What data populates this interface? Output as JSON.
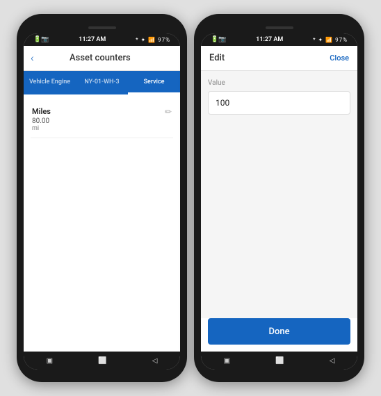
{
  "phone1": {
    "status_bar": {
      "left": "🔋📷",
      "right_icons": "* ✦ 📶 97%",
      "time": "11:27 AM"
    },
    "nav": {
      "back_label": "‹",
      "title": "Asset counters"
    },
    "tabs": [
      {
        "id": "vehicle-engine",
        "label": "Vehicle Engine",
        "active": false
      },
      {
        "id": "ny-01-wh-3",
        "label": "NY-01-WH-3",
        "active": false
      },
      {
        "id": "service",
        "label": "Service",
        "active": true
      }
    ],
    "counter": {
      "name": "Miles",
      "value": "80.00",
      "unit": "mi"
    },
    "bottom_nav": {
      "icons": [
        "▣",
        "⬜",
        "◁"
      ]
    }
  },
  "phone2": {
    "status_bar": {
      "left": "🔋📷",
      "right_icons": "* ✦ 📶 97%",
      "time": "11:27 AM"
    },
    "nav": {
      "edit_label": "Edit",
      "close_label": "Close"
    },
    "field": {
      "label": "Value",
      "value": "100"
    },
    "done_button": "Done",
    "bottom_nav": {
      "icons": [
        "▣",
        "⬜",
        "◁"
      ]
    }
  }
}
